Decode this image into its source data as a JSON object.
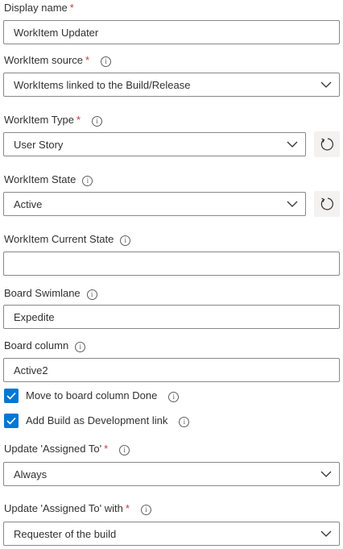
{
  "fields": {
    "display_name": {
      "label": "Display name",
      "required": "*",
      "value": "WorkItem Updater"
    },
    "workitem_source": {
      "label": "WorkItem source",
      "required": "*",
      "info": "i",
      "value": "WorkItems linked to the Build/Release"
    },
    "workitem_type": {
      "label": "WorkItem Type",
      "required": "*",
      "info": "i",
      "value": "User Story"
    },
    "workitem_state": {
      "label": "WorkItem State",
      "info": "i",
      "value": "Active"
    },
    "workitem_current_state": {
      "label": "WorkItem Current State",
      "info": "i",
      "value": ""
    },
    "board_swimlane": {
      "label": "Board Swimlane",
      "info": "i",
      "value": "Expedite"
    },
    "board_column": {
      "label": "Board column",
      "info": "i",
      "value": "Active2"
    },
    "move_to_done": {
      "label": "Move to board column Done",
      "checked": true,
      "info": "i"
    },
    "add_dev_link": {
      "label": "Add Build as Development link",
      "checked": true,
      "info": "i"
    },
    "update_assigned_to": {
      "label": "Update 'Assigned To'",
      "required": "*",
      "info": "i",
      "value": "Always"
    },
    "update_assigned_to_with": {
      "label": "Update 'Assigned To' with",
      "required": "*",
      "info": "i",
      "value": "Requester of the build"
    }
  },
  "colors": {
    "accent": "#0078d4",
    "required": "#d13438",
    "border": "#8a8886",
    "text": "#323130"
  },
  "icons": {
    "dropdown": "chevron-down-icon",
    "refresh": "refresh-icon",
    "info": "info-icon",
    "check": "checkmark-icon"
  }
}
